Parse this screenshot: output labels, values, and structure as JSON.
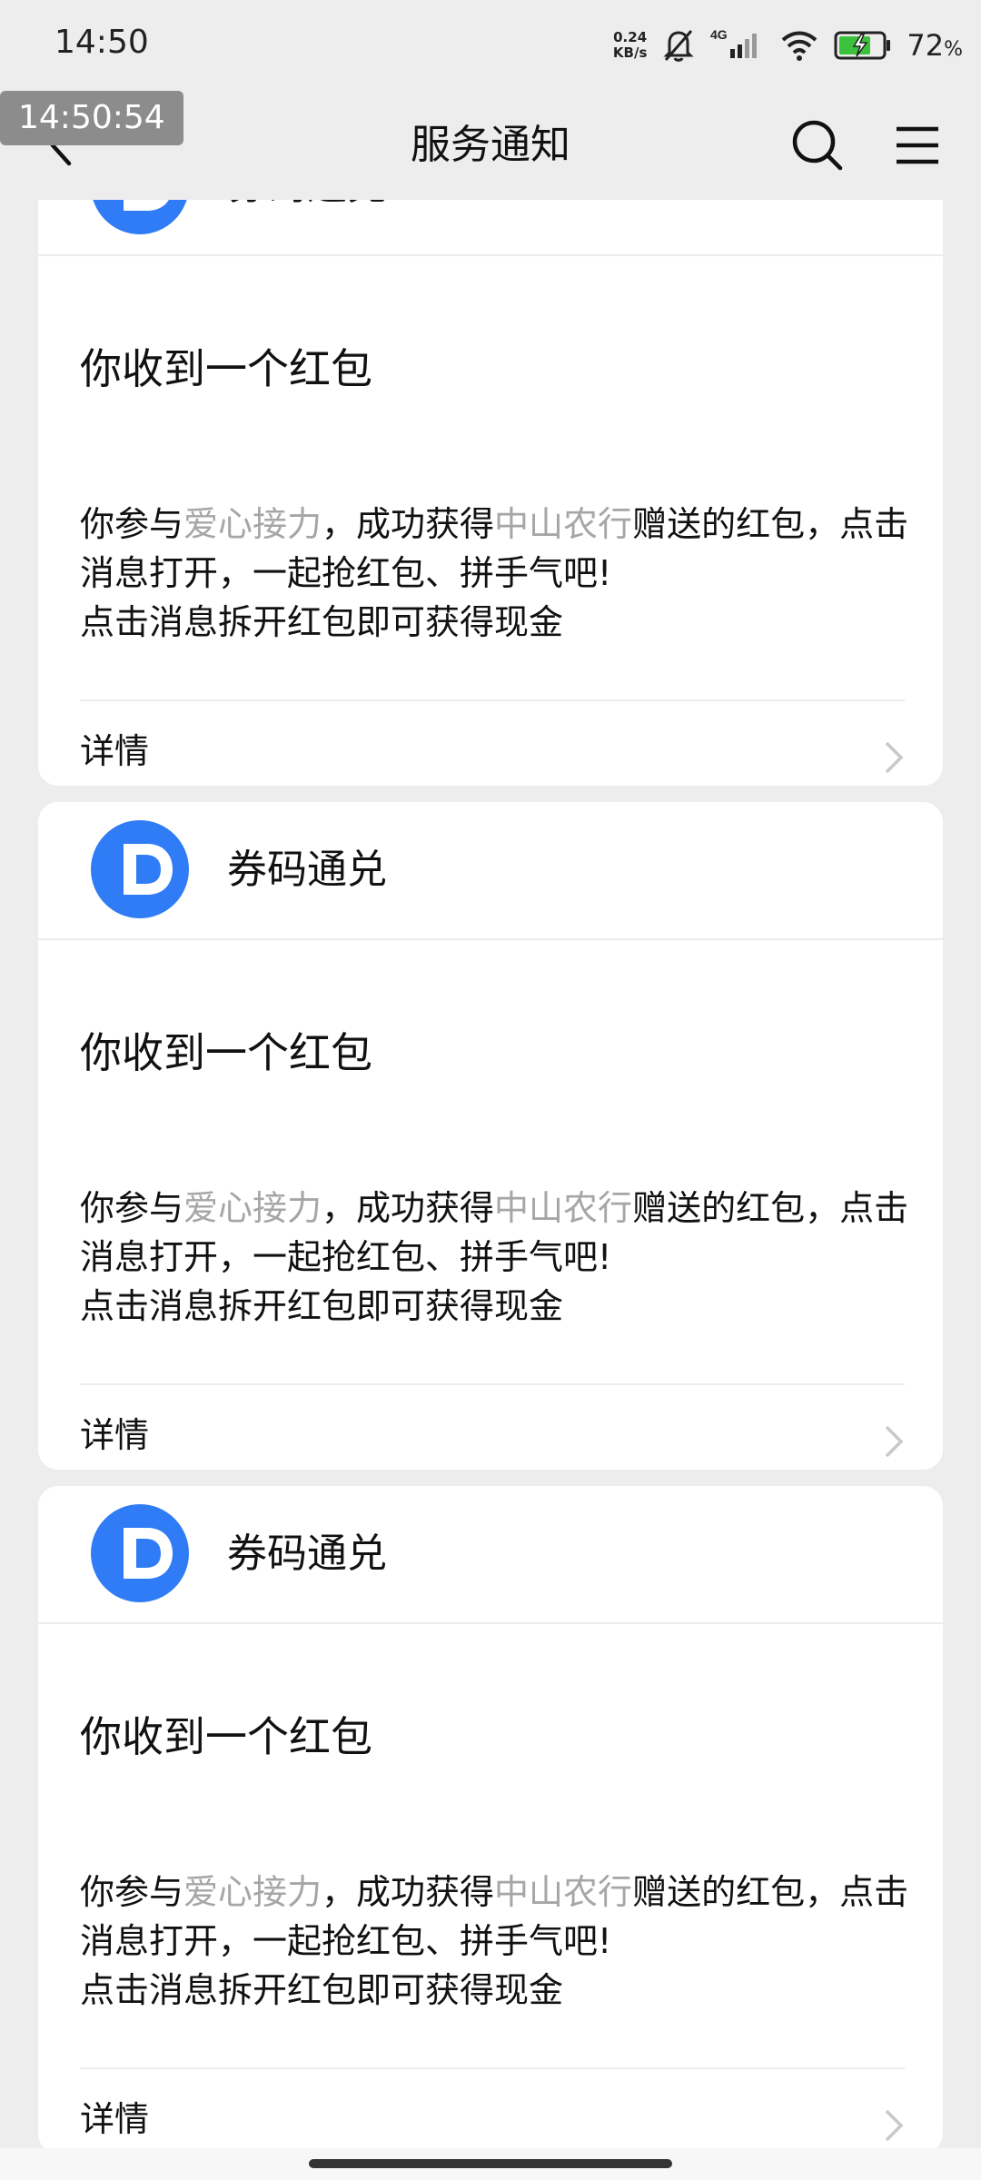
{
  "status_bar": {
    "time": "14:50",
    "net_speed_value": "0.24",
    "net_speed_unit": "KB/s",
    "network_type": "4G",
    "battery_percent": "72",
    "battery_unit": "%",
    "icons": [
      "mute-bell-icon",
      "signal-icon",
      "wifi-icon",
      "battery-charging-icon"
    ]
  },
  "overlay_time": "14:50:54",
  "nav": {
    "title": "服务通知",
    "icons": [
      "back-arrow-icon",
      "search-icon",
      "menu-icon"
    ]
  },
  "colors": {
    "background": "#ededed",
    "card": "#ffffff",
    "logo_blue": "#2f7cf6",
    "highlight_text": "#a6a6a6"
  },
  "cards": [
    {
      "sender": "券码通兑",
      "title": "你收到一个红包",
      "body": {
        "p1": "你参与",
        "h1": "爱心接力",
        "p2": "，成功获得",
        "h2": "中山农行",
        "p3": "赠送的红包，点击消息打开，一起抢红包、拼手气吧!",
        "line2": "点击消息拆开红包即可获得现金"
      },
      "details": "详情"
    },
    {
      "sender": "券码通兑",
      "title": "你收到一个红包",
      "body": {
        "p1": "你参与",
        "h1": "爱心接力",
        "p2": "，成功获得",
        "h2": "中山农行",
        "p3": "赠送的红包，点击消息打开，一起抢红包、拼手气吧!",
        "line2": "点击消息拆开红包即可获得现金"
      },
      "details": "详情"
    },
    {
      "sender": "券码通兑",
      "title": "你收到一个红包",
      "body": {
        "p1": "你参与",
        "h1": "爱心接力",
        "p2": "，成功获得",
        "h2": "中山农行",
        "p3": "赠送的红包，点击消息打开，一起抢红包、拼手气吧!",
        "line2": "点击消息拆开红包即可获得现金"
      },
      "details": "详情"
    }
  ]
}
